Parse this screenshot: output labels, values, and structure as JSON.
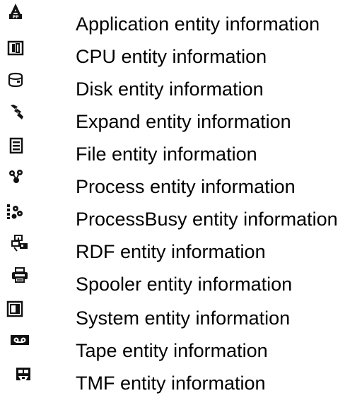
{
  "legend": {
    "items": [
      {
        "icon": "application-icon",
        "label": "Application entity information"
      },
      {
        "icon": "cpu-icon",
        "label": "CPU entity information"
      },
      {
        "icon": "disk-icon",
        "label": "Disk entity information"
      },
      {
        "icon": "expand-icon",
        "label": "Expand entity information"
      },
      {
        "icon": "file-icon",
        "label": "File entity information"
      },
      {
        "icon": "process-icon",
        "label": "Process entity information"
      },
      {
        "icon": "process-busy-icon",
        "label": "ProcessBusy entity information"
      },
      {
        "icon": "rdf-icon",
        "label": "RDF entity information"
      },
      {
        "icon": "spooler-icon",
        "label": "Spooler entity information"
      },
      {
        "icon": "system-icon",
        "label": "System entity information"
      },
      {
        "icon": "tape-icon",
        "label": "Tape entity information"
      },
      {
        "icon": "tmf-icon",
        "label": "TMF entity information"
      }
    ]
  }
}
